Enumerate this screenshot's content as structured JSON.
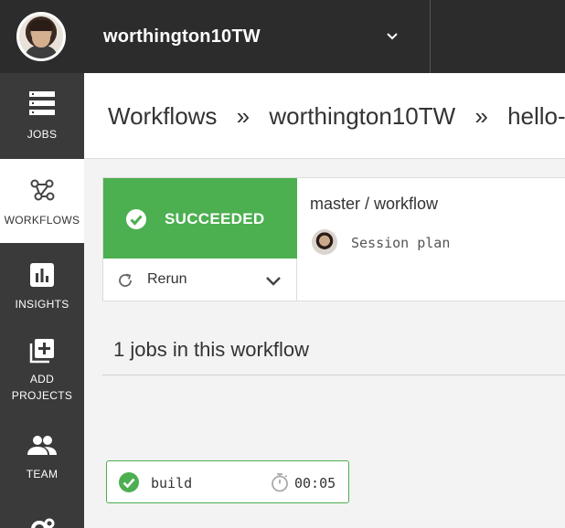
{
  "header": {
    "org_name": "worthington10TW",
    "icons": {
      "avatar": "user-avatar",
      "dropdown": "chevron-down-icon"
    }
  },
  "sidebar": {
    "items": [
      {
        "label": "JOBS",
        "icon": "jobs-list-icon",
        "active": false
      },
      {
        "label": "WORKFLOWS",
        "icon": "workflows-icon",
        "active": true
      },
      {
        "label": "INSIGHTS",
        "icon": "insights-chart-icon",
        "active": false
      },
      {
        "label": "ADD PROJECTS",
        "icon": "add-project-icon",
        "active": false
      },
      {
        "label": "TEAM",
        "icon": "team-icon",
        "active": false
      },
      {
        "label": "",
        "icon": "settings-gear-icon",
        "active": false
      }
    ]
  },
  "breadcrumb": {
    "items": [
      "Workflows",
      "»",
      "worthington10TW",
      "»",
      "hello-ka"
    ]
  },
  "workflow": {
    "status": "SUCCEEDED",
    "status_color": "#4caf50",
    "rerun_label": "Rerun",
    "branch_title": "master / workflow",
    "commit_message": "Session plan"
  },
  "jobs": {
    "heading": "1 jobs in this workflow",
    "items": [
      {
        "name": "build",
        "duration": "00:05",
        "status": "success"
      }
    ]
  },
  "colors": {
    "topbar": "#2c2c2c",
    "sidebar": "#3a3a3a",
    "success": "#4caf50"
  }
}
